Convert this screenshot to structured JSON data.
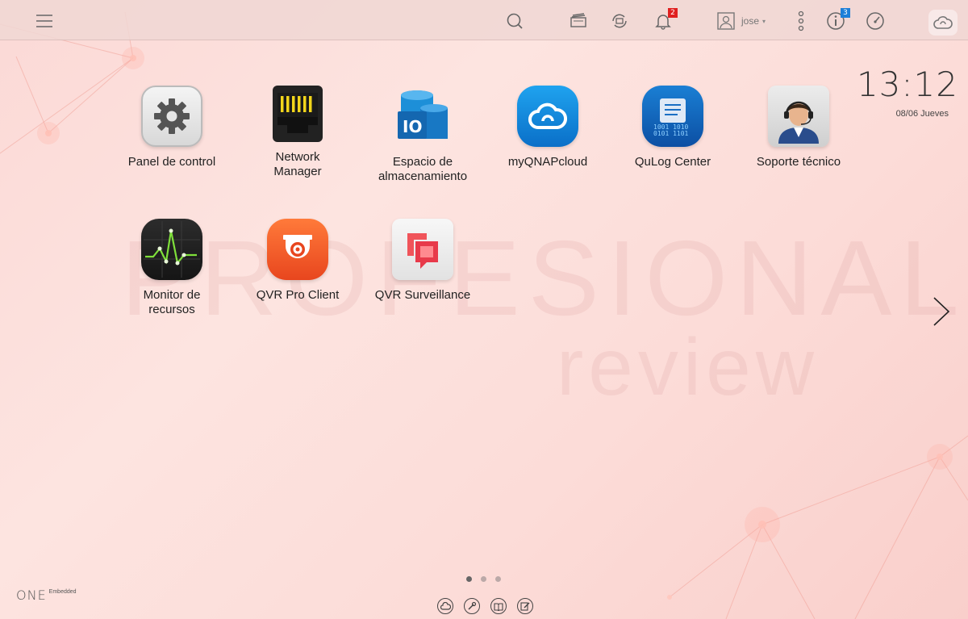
{
  "topbar": {
    "menu_icon": "hamburger-menu-icon",
    "search_icon": "search-icon",
    "tasks_icon": "background-tasks-icon",
    "sync_icon": "external-device-sync-icon",
    "notifications_icon": "bell-icon",
    "notifications_count": "2",
    "user_name": "jose",
    "user_caret": "▾",
    "more_icon": "vertical-dots-icon",
    "info_icon": "info-icon",
    "info_count": "3",
    "dashboard_icon": "dashboard-gauge-icon",
    "cloud_icon": "cloud-icon"
  },
  "clock": {
    "time": "13:12",
    "date": "08/06 Jueves"
  },
  "apps": [
    {
      "label": "Panel de control",
      "icon": "gear-icon"
    },
    {
      "label": "Network\nManager",
      "icon": "network-port-icon"
    },
    {
      "label": "Espacio de\nalmacenamiento",
      "icon": "storage-database-icon"
    },
    {
      "label": "myQNAPcloud",
      "icon": "cloud-icon"
    },
    {
      "label": "QuLog Center",
      "icon": "log-binary-icon"
    },
    {
      "label": "Soporte técnico",
      "icon": "support-agent-icon"
    },
    {
      "label": "Monitor de\nrecursos",
      "icon": "resource-monitor-graph-icon"
    },
    {
      "label": "QVR Pro Client",
      "icon": "security-camera-icon"
    },
    {
      "label": "QVR Surveillance",
      "icon": "surveillance-logo-icon"
    }
  ],
  "watermark": {
    "line1": "PROFESIONAL",
    "line2": "review"
  },
  "pager": {
    "pages": 3,
    "active": 0
  },
  "bottom_bar": [
    "myqnapcloud-icon",
    "tools-icon",
    "manual-book-icon",
    "feedback-edit-icon"
  ],
  "brand": {
    "name": "ONE",
    "sub": "Embedded"
  },
  "colors": {
    "accent_blue": "#1e7fd8",
    "badge_red": "#e02020",
    "qvr_orange": "#f05a28"
  }
}
